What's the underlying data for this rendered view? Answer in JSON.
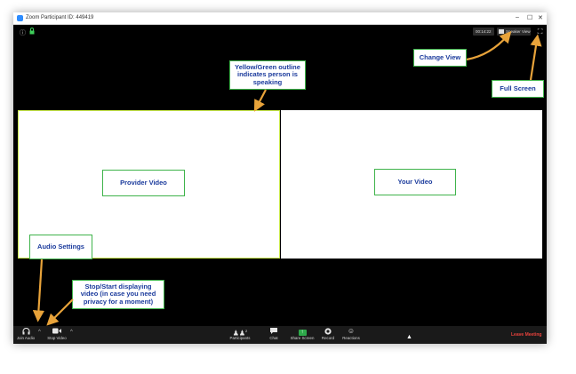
{
  "window": {
    "title": "Zoom Participant ID: 449419",
    "controls": {
      "minimize": "–",
      "maximize": "☐",
      "close": "✕"
    }
  },
  "topbar": {
    "timer": "00:14:22",
    "speaker_view_label": "Speaker View"
  },
  "annotations": {
    "change_view": "Change View",
    "full_screen": "Full Screen",
    "speaking_outline": "Yellow/Green outline indicates person is speaking",
    "provider_video": "Provider Video",
    "your_video": "Your Video",
    "audio_settings": "Audio Settings",
    "stop_start_video": "Stop/Start displaying video (in case you need privacy for a moment)"
  },
  "toolbar": {
    "join_audio": "Join Audio",
    "stop_video": "Stop Video",
    "participants": "Participants",
    "participants_count": "2",
    "chat": "Chat",
    "share_screen": "Share Screen",
    "record": "Record",
    "reactions": "Reactions",
    "leave_meeting": "Leave Meeting"
  },
  "colors": {
    "annotation_border": "#3eb34a",
    "annotation_text": "#1a3a9c",
    "arrow": "#e8a33a",
    "speaking_outline": "#c8e84a",
    "leave": "#e8423c",
    "share": "#2ea84a"
  },
  "icons": [
    "zoom-logo-icon",
    "info-icon",
    "lock-icon",
    "grid-icon",
    "fullscreen-icon",
    "headphones-icon",
    "camera-icon",
    "participants-icon",
    "chat-icon",
    "share-screen-icon",
    "record-icon",
    "reactions-icon",
    "cursor-icon"
  ]
}
